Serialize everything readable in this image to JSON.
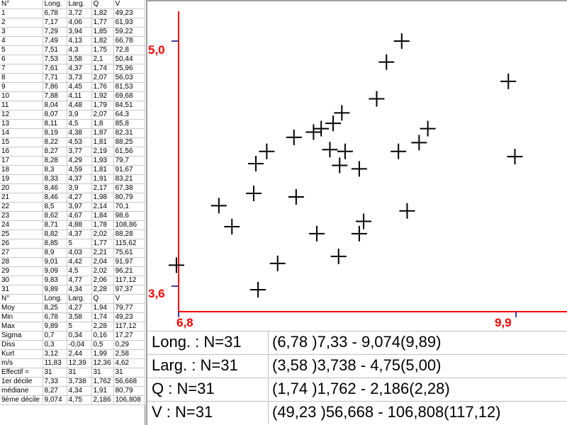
{
  "table": {
    "headers": [
      "N°",
      "Long.",
      "Larg.",
      "Q",
      "V"
    ],
    "rows": [
      [
        "1",
        "6,78",
        "3,72",
        "1,82",
        "49,23"
      ],
      [
        "2",
        "7,17",
        "4,06",
        "1,77",
        "61,93"
      ],
      [
        "3",
        "7,29",
        "3,94",
        "1,85",
        "59,22"
      ],
      [
        "4",
        "7,49",
        "4,13",
        "1,82",
        "66,78"
      ],
      [
        "5",
        "7,51",
        "4,3",
        "1,75",
        "72,8"
      ],
      [
        "6",
        "7,53",
        "3,58",
        "2,1",
        "50,44"
      ],
      [
        "7",
        "7,61",
        "4,37",
        "1,74",
        "75,96"
      ],
      [
        "8",
        "7,71",
        "3,73",
        "2,07",
        "56,03"
      ],
      [
        "9",
        "7,86",
        "4,45",
        "1,76",
        "81,53"
      ],
      [
        "10",
        "7,88",
        "4,11",
        "1,92",
        "69,68"
      ],
      [
        "11",
        "8,04",
        "4,48",
        "1,79",
        "84,51"
      ],
      [
        "12",
        "8,07",
        "3,9",
        "2,07",
        "64,3"
      ],
      [
        "13",
        "8,11",
        "4,5",
        "1,8",
        "85,8"
      ],
      [
        "14",
        "8,19",
        "4,38",
        "1,87",
        "82,31"
      ],
      [
        "15",
        "8,22",
        "4,53",
        "1,81",
        "88,25"
      ],
      [
        "16",
        "8,27",
        "3,77",
        "2,19",
        "61,56"
      ],
      [
        "17",
        "8,28",
        "4,29",
        "1,93",
        "79,7"
      ],
      [
        "18",
        "8,3",
        "4,59",
        "1,81",
        "91,67"
      ],
      [
        "19",
        "8,33",
        "4,37",
        "1,91",
        "83,21"
      ],
      [
        "20",
        "8,46",
        "3,9",
        "2,17",
        "67,38"
      ],
      [
        "21",
        "8,46",
        "4,27",
        "1,98",
        "80,79"
      ],
      [
        "22",
        "8,5",
        "3,97",
        "2,14",
        "70,1"
      ],
      [
        "23",
        "8,62",
        "4,67",
        "1,84",
        "98,6"
      ],
      [
        "24",
        "8,71",
        "4,88",
        "1,78",
        "108,86"
      ],
      [
        "25",
        "8,82",
        "4,37",
        "2,02",
        "88,28"
      ],
      [
        "26",
        "8,85",
        "5",
        "1,77",
        "115,62"
      ],
      [
        "27",
        "8,9",
        "4,03",
        "2,21",
        "75,61"
      ],
      [
        "28",
        "9,01",
        "4,42",
        "2,04",
        "91,97"
      ],
      [
        "29",
        "9,09",
        "4,5",
        "2,02",
        "96,21"
      ],
      [
        "30",
        "9,83",
        "4,77",
        "2,06",
        "117,12"
      ],
      [
        "31",
        "9,89",
        "4,34",
        "2,28",
        "97,37"
      ]
    ],
    "stats_headers": [
      "N°",
      "Long.",
      "Larg.",
      "Q",
      "V"
    ],
    "stats": [
      [
        "Moy",
        "8,25",
        "4,27",
        "1,94",
        "79,77"
      ],
      [
        "Min",
        "6,78",
        "3,58",
        "1,74",
        "49,23"
      ],
      [
        "Max",
        "9,89",
        "5",
        "2,28",
        "117,12"
      ],
      [
        "Sigma",
        "0,7",
        "0,34",
        "0,16",
        "17,27"
      ],
      [
        "Diss",
        "0,3",
        "-0,04",
        "0,5",
        "0,29"
      ],
      [
        "Kurt",
        "3,12",
        "2,44",
        "1,99",
        "2,58"
      ],
      [
        "m/s",
        "11,83",
        "12,39",
        "12,36",
        "4,62"
      ],
      [
        "Effectif =",
        "31",
        "31",
        "31",
        "31"
      ],
      [
        "1er décile",
        "7,33",
        "3,738",
        "1,762",
        "56,668"
      ],
      [
        "médiane",
        "8,27",
        "4,34",
        "1,91",
        "80,79"
      ],
      [
        "9ème décile",
        "9,074",
        "4,75",
        "2,186",
        "106,808"
      ]
    ]
  },
  "chart_data": {
    "type": "scatter",
    "x": [
      6.78,
      7.17,
      7.29,
      7.49,
      7.51,
      7.53,
      7.61,
      7.71,
      7.86,
      7.88,
      8.04,
      8.07,
      8.11,
      8.19,
      8.22,
      8.27,
      8.28,
      8.3,
      8.33,
      8.46,
      8.46,
      8.5,
      8.62,
      8.71,
      8.82,
      8.85,
      8.9,
      9.01,
      9.09,
      9.83,
      9.89
    ],
    "y": [
      3.72,
      4.06,
      3.94,
      4.13,
      4.3,
      3.58,
      4.37,
      3.73,
      4.45,
      4.11,
      4.48,
      3.9,
      4.5,
      4.38,
      4.53,
      3.77,
      4.29,
      4.59,
      4.37,
      3.9,
      4.27,
      3.97,
      4.67,
      4.88,
      4.37,
      5.0,
      4.03,
      4.42,
      4.5,
      4.77,
      4.34
    ],
    "xlim": [
      6.8,
      9.9
    ],
    "ylim": [
      3.6,
      5.0
    ],
    "x_tick_labels": [
      "6,8",
      "9,9"
    ],
    "y_tick_labels": [
      "5,0",
      "3,6"
    ],
    "axis_color": "#ff0000",
    "marker": "+",
    "marker_color": "#000000",
    "grid": false
  },
  "summary": [
    {
      "name": "Long. : N=31",
      "range": "(6,78 )7,33 - 9,074(9,89)"
    },
    {
      "name": "Larg. : N=31",
      "range": "(3,58 )3,738 - 4,75(5,00)"
    },
    {
      "name": "Q : N=31",
      "range": "(1,74 )1,762 - 2,186(2,28)"
    },
    {
      "name": "V : N=31",
      "range": "(49,23 )56,668 - 106,808(117,12)"
    }
  ]
}
